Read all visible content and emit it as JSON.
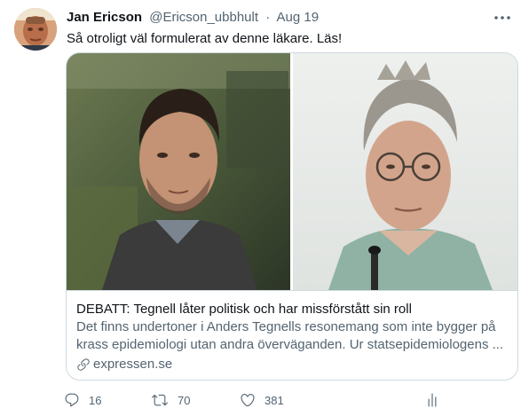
{
  "author": {
    "name": "Jan Ericson",
    "handle": "@Ericson_ubbhult",
    "separator": "·",
    "date": "Aug 19"
  },
  "tweet": {
    "text": "Så otroligt väl formulerat av denne läkare. Läs!"
  },
  "card": {
    "title": "DEBATT: Tegnell låter politisk och har missförstått sin roll",
    "description": "Det finns undertoner i Anders Tegnells resonemang som inte bygger på krass epidemiologi utan andra överväganden. Ur statsepidemiologens ...",
    "domain": "expressen.se"
  },
  "actions": {
    "reply_count": "16",
    "retweet_count": "70",
    "like_count": "381"
  },
  "icons": {
    "more": "more-icon",
    "reply": "reply-icon",
    "retweet": "retweet-icon",
    "like": "heart-icon",
    "analytics": "analytics-icon",
    "link": "link-icon"
  },
  "colors": {
    "text_primary": "#0f1419",
    "text_secondary": "#536471",
    "border": "#cfd9de"
  }
}
